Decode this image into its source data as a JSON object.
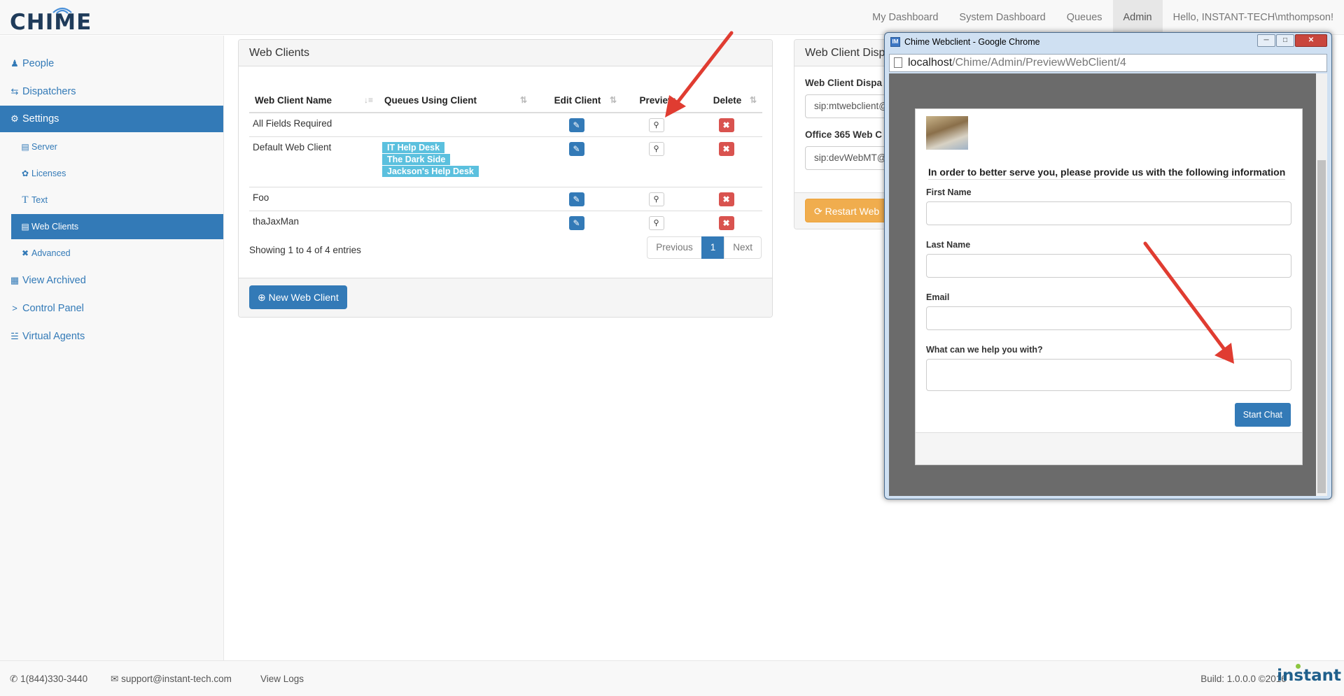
{
  "brand": {
    "name": "CHIME"
  },
  "nav": {
    "items": [
      "My Dashboard",
      "System Dashboard",
      "Queues",
      "Admin",
      "Hello, INSTANT-TECH\\mthompson!"
    ],
    "active": "Admin"
  },
  "sidebar": {
    "people": "People",
    "dispatchers": "Dispatchers",
    "settings": "Settings",
    "server": "Server",
    "licenses": "Licenses",
    "text": "Text",
    "web_clients": "Web Clients",
    "advanced": "Advanced",
    "view_archived": "View Archived",
    "control_panel": "Control Panel",
    "virtual_agents": "Virtual Agents"
  },
  "webclients": {
    "title": "Web Clients",
    "columns": [
      "Web Client Name",
      "Queues Using Client",
      "Edit Client",
      "Preview",
      "Delete"
    ],
    "rows": [
      {
        "name": "All Fields Required",
        "queues": []
      },
      {
        "name": "Default Web Client",
        "queues": [
          "IT Help Desk",
          "The Dark Side",
          "Jackson's Help Desk"
        ]
      },
      {
        "name": "Foo",
        "queues": []
      },
      {
        "name": "thaJaxMan",
        "queues": []
      }
    ],
    "showing": "Showing 1 to 4 of 4 entries",
    "pager": {
      "previous": "Previous",
      "current": "1",
      "next": "Next"
    },
    "new_button": "New Web Client"
  },
  "dispatcher_panel": {
    "title": "Web Client Disp",
    "field1_label": "Web Client Dispa",
    "field1_value": "sip:mtwebclient@",
    "field2_label": "Office 365 Web C",
    "field2_value": "sip:devWebMT@",
    "restart_button": "Restart Web"
  },
  "popup": {
    "window_title": "Chime Webclient - Google Chrome",
    "url_host": "localhost",
    "url_path": "/Chime/Admin/PreviewWebClient/4",
    "intro": "In order to better serve you, please provide us with the following information",
    "first_name": "First Name",
    "last_name": "Last Name",
    "email": "Email",
    "help": "What can we help you with?",
    "start_chat": "Start Chat"
  },
  "footer": {
    "phone": "1(844)330-3440",
    "email": "support@instant-tech.com",
    "view_logs": "View Logs",
    "build": "Build: 1.0.0.0 ©2016 -",
    "company": "instant"
  },
  "colors": {
    "primary": "#337ab7",
    "danger": "#d9534f",
    "info": "#5bc0de",
    "warning": "#f0ad4e",
    "arrow": "#e03c31"
  }
}
